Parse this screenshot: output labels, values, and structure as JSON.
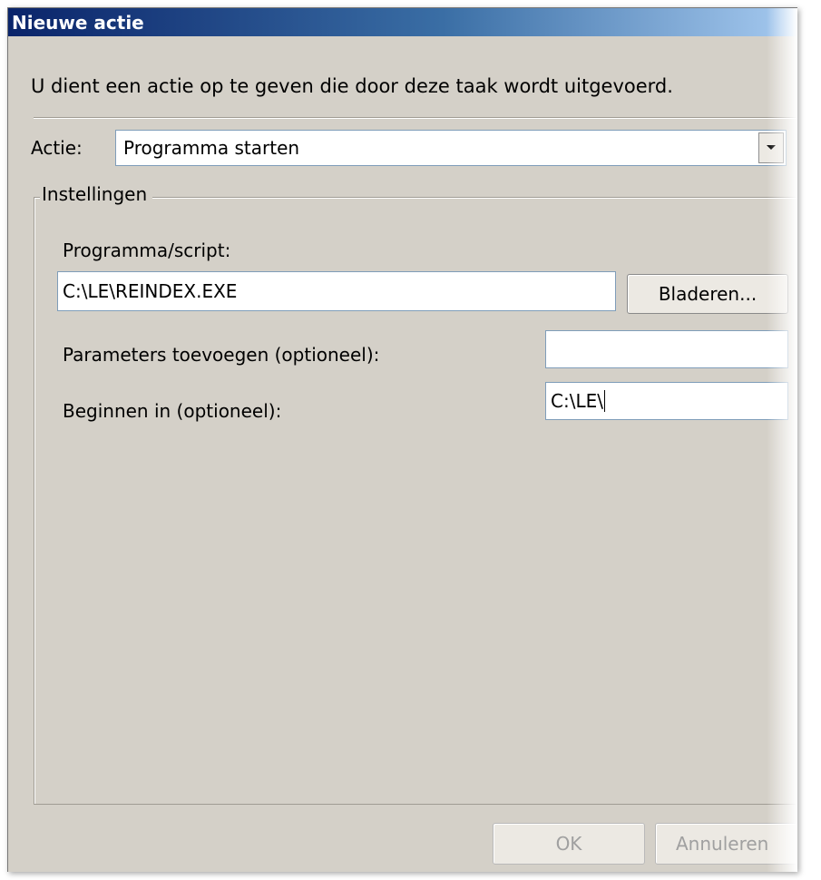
{
  "window": {
    "title": "Nieuwe actie"
  },
  "intro_text": "U dient een actie op te geven die door deze taak wordt uitgevoerd.",
  "action": {
    "label": "Actie:",
    "selected": "Programma starten"
  },
  "settings": {
    "group_label": "Instellingen",
    "program_label": "Programma/script:",
    "program_value": "C:\\LE\\REINDEX.EXE",
    "browse_label": "Bladeren...",
    "params_label": "Parameters toevoegen (optioneel):",
    "params_value": "",
    "start_in_label": "Beginnen in (optioneel):",
    "start_in_value": "C:\\LE\\"
  },
  "footer": {
    "ok_label": "OK",
    "cancel_label": "Annuleren"
  },
  "icons": {
    "combo_arrow": "chevron-down-icon"
  }
}
